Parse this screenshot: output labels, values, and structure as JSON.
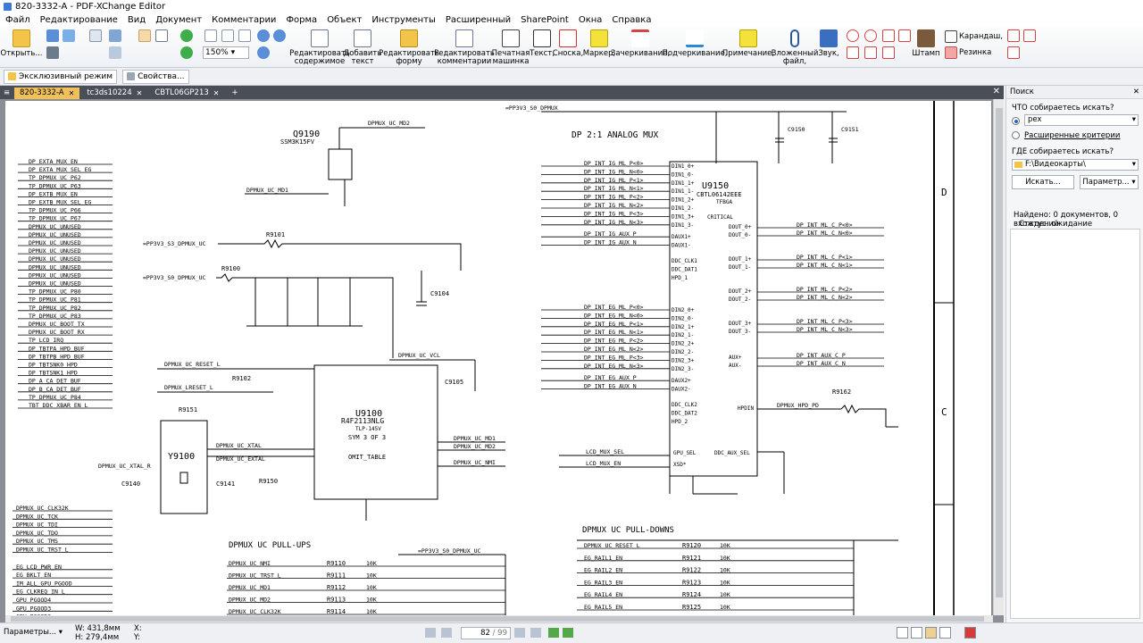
{
  "window": {
    "title": "820-3332-A - PDF-XChange Editor"
  },
  "menu": [
    "Файл",
    "Редактирование",
    "Вид",
    "Документ",
    "Комментарии",
    "Форма",
    "Объект",
    "Инструменты",
    "Расширенный",
    "SharePoint",
    "Окна",
    "Справка"
  ],
  "toolbar": {
    "open": "Открыть...",
    "zoom": "150%",
    "edit_content": [
      "Редактировать",
      "содержимое"
    ],
    "add_text": [
      "Добавить",
      "текст"
    ],
    "edit_form": [
      "Редактировать",
      "форму"
    ],
    "edit_comments": [
      "Редактировать",
      "комментарии"
    ],
    "typewriter": [
      "Печатная",
      "машинка"
    ],
    "text": "Текст,",
    "callout": "Сноска,",
    "highlight": "Маркер,",
    "strikeout": "Зачеркивание,",
    "underline": "Подчеркивание,",
    "note": "Примечание,",
    "attachment": [
      "Вложенный",
      "файл,"
    ],
    "sound": "Звук,",
    "stamp": "Штамп",
    "pencil": "Карандаш,",
    "eraser": "Резинка"
  },
  "modebar": {
    "exclusive": "Эксклюзивный режим",
    "properties": "Свойства..."
  },
  "tabs": [
    {
      "label": "820-3332-A",
      "active": true
    },
    {
      "label": "tc3ds10224",
      "active": false
    },
    {
      "label": "CBTL06GP213",
      "active": false
    }
  ],
  "schematic": {
    "title_dp": "DP 2:1 ANALOG MUX",
    "u9150": "U9150",
    "u9150_part": "CBTL06142EEE",
    "u9150_pkg": "TFBGA",
    "critical": "CRITICAL",
    "u9100": "U9100",
    "u9100_part": "R4F2113NLG",
    "u9100_pkg": "TLP-145V",
    "sym": "SYM 3 OF 3",
    "omit": "OMIT_TABLE",
    "q9190": "Q9190",
    "q9190_part": "SSM3K15FV",
    "y9100": "Y9100",
    "pullups": "DPMUX UC PULL-UPS",
    "pulldowns": "DPMUX UC PULL-DOWNS",
    "pp3v3_s0": "=PP3V3_S0_DPMUX",
    "pp3v3_s3": "=PP3V3_S3_DPMUX_UC",
    "pp3v3_s0uc": "=PP3V3_S0_DPMUX_UC",
    "zone_d": "D",
    "zone_c": "C",
    "c9104": "C9104",
    "c9105": "C9105",
    "c9150": "C9150",
    "c9151": "C9151",
    "r9162": "R9162",
    "r9101": "R9101",
    "r9100": "R9100",
    "r9102": "R9102",
    "r9151": "R9151",
    "r9150": "R9150",
    "c9140": "C9140",
    "c9141": "C9141",
    "md2": "DPMUX_UC_MD2",
    "md1": "DPMUX_UC_MD1",
    "vcl": "DPMUX_UC_VCL",
    "reset_l": "DPMUX_UC_RESET_L",
    "lreset_l": "DPMUX_LRESET_L",
    "xtal": "DPMUX_UC_XTAL",
    "extal": "DPMUX_UC_EXTAL",
    "xtal_r": "DPMUX_UC_XTAL_R",
    "nmi": "DPMUX_UC_NMI",
    "hpd_pd": "DPMUX_HPD_PD",
    "gpu_sel": "LCD_MUX_SEL",
    "lcd_mux_en": "LCD_MUX_EN",
    "left_nets": [
      "DP_EXTA_MUX_EN",
      "DP_EXTA_MUX_SEL_EG",
      "TP_DPMUX_UC_P62",
      "TP_DPMUX_UC_P63",
      "DP_EXTB_MUX_EN",
      "DP_EXTB_MUX_SEL_EG",
      "TP_DPMUX_UC_P66",
      "TP_DPMUX_UC_P67",
      "DPMUX_UC_UNUSED",
      "DPMUX_UC_UNUSED",
      "DPMUX_UC_UNUSED",
      "DPMUX_UC_UNUSED",
      "DPMUX_UC_UNUSED",
      "DPMUX_UC_UNUSED",
      "DPMUX_UC_UNUSED",
      "DPMUX_UC_UNUSED",
      "TP_DPMUX_UC_P80",
      "TP_DPMUX_UC_P81",
      "TP_DPMUX_UC_P82",
      "TP_DPMUX_UC_P83",
      "DPMUX_UC_BOOT_TX",
      "DPMUX_UC_BOOT_RX",
      "TP_LCD_IRQ",
      "DP_TBTPA_HPD_BUF",
      "DP_TBTPB_HPD_BUF",
      "DP_TBTSNK0_HPD",
      "DP_TBTSNK1_HPD",
      "DP_A_CA_DET_BUF",
      "DP_B_CA_DET_BUF",
      "TP_DPMUX_UC_P84",
      "TBT_DDC_XBAR_EN_L"
    ],
    "left_nets_bottom": [
      "DPMUX_UC_CLK32K",
      "DPMUX_UC_TCK",
      "DPMUX_UC_TDI",
      "DPMUX_UC_TDO",
      "DPMUX_UC_TMS",
      "DPMUX_UC_TRST_L",
      "EG_LCD_PWR_EN",
      "EG_BKLT_EN",
      "IM_ALL_GPU_PGOOD",
      "EG_CLKREQ_IN_L",
      "GPU_PGOOD4",
      "GPU_PGOOD3",
      "GPU_PGOOD2"
    ],
    "mid_nets": [
      "DP_INT_IG_ML_P<0>",
      "DP_INT_IG_ML_N<0>",
      "DP_INT_IG_ML_P<1>",
      "DP_INT_IG_ML_N<1>",
      "DP_INT_IG_ML_P<2>",
      "DP_INT_IG_ML_N<2>",
      "DP_INT_IG_ML_P<3>",
      "DP_INT_IG_ML_N<3>",
      "DP_INT_IG_AUX_P",
      "DP_INT_IG_AUX_N"
    ],
    "mid_nets2": [
      "DP_INT_EG_ML_P<0>",
      "DP_INT_EG_ML_N<0>",
      "DP_INT_EG_ML_P<1>",
      "DP_INT_EG_ML_N<1>",
      "DP_INT_EG_ML_P<2>",
      "DP_INT_EG_ML_N<2>",
      "DP_INT_EG_ML_P<3>",
      "DP_INT_EG_ML_N<3>",
      "DP_INT_EG_AUX_P",
      "DP_INT_EG_AUX_N"
    ],
    "u_pins_left": [
      "DIN1_0+",
      "DIN1_0-",
      "DIN1_1+",
      "DIN1_1-",
      "DIN1_2+",
      "DIN1_2-",
      "DIN1_3+",
      "DIN1_3-",
      "DAUX1+",
      "DAUX1-",
      "DDC_CLK1",
      "DDC_DAT1",
      "HPD_1",
      "DIN2_0+",
      "DIN2_0-",
      "DIN2_1+",
      "DIN2_1-",
      "DIN2_2+",
      "DIN2_2-",
      "DIN2_3+",
      "DIN2_3-",
      "DAUX2+",
      "DAUX2-",
      "DDC_CLK2",
      "DDC_DAT2",
      "HPD_2",
      "GPU_SEL",
      "XSD*"
    ],
    "u_pins_right": [
      "DOUT_0+",
      "DOUT_0-",
      "DOUT_1+",
      "DOUT_1-",
      "DOUT_2+",
      "DOUT_2-",
      "DOUT_3+",
      "DOUT_3-",
      "AUX+",
      "AUX-",
      "HPDIN",
      "DDC_AUX_SEL"
    ],
    "right_nets": [
      "DP_INT_ML_C_P<0>",
      "DP_INT_ML_C_N<0>",
      "DP_INT_ML_C_P<1>",
      "DP_INT_ML_C_N<1>",
      "DP_INT_ML_C_P<2>",
      "DP_INT_ML_C_N<2>",
      "DP_INT_ML_C_P<3>",
      "DP_INT_ML_C_N<3>",
      "DP_INT_AUX_C_P",
      "DP_INT_AUX_C_N"
    ],
    "pullup_rows": [
      {
        "net": "DPMUX_UC_NMI",
        "ref": "R9110",
        "val": "10K"
      },
      {
        "net": "DPMUX_UC_TRST_L",
        "ref": "R9111",
        "val": "10K"
      },
      {
        "net": "DPMUX_UC_MD1",
        "ref": "R9112",
        "val": "10K"
      },
      {
        "net": "DPMUX_UC_MD2",
        "ref": "R9113",
        "val": "10K"
      },
      {
        "net": "DPMUX_UC_CLK32K",
        "ref": "R9114",
        "val": "10K"
      }
    ],
    "pulldown_rows": [
      {
        "net": "DPMUX_UC_RESET_L",
        "ref": "R9120",
        "val": "10K"
      },
      {
        "net": "EG_RAIL1_EN",
        "ref": "R9121",
        "val": "10K"
      },
      {
        "net": "EG_RAIL2_EN",
        "ref": "R9122",
        "val": "10K"
      },
      {
        "net": "EG_RAIL3_EN",
        "ref": "R9123",
        "val": "10K"
      },
      {
        "net": "EG_RAIL4_EN",
        "ref": "R9124",
        "val": "10K"
      },
      {
        "net": "EG_RAIL5_EN",
        "ref": "R9125",
        "val": "10K"
      }
    ]
  },
  "search": {
    "title": "Поиск",
    "what_label": "ЧТО собираетесь искать?",
    "query": "pex",
    "advanced": "Расширенные критерии",
    "where_label": "ГДЕ собираетесь искать?",
    "where": "F:\\Видеокарты\\",
    "search_btn": "Искать...",
    "params_btn": "Параметр...",
    "found": "Найдено: 0 документов, 0 вхождений",
    "status": "Статус: ожидание"
  },
  "statusbar": {
    "params": "Параметры...",
    "width": "W: 431,8мм",
    "height": "H: 279,4мм",
    "xy": "X:",
    "y": "Y:",
    "page": "82",
    "total": "/ 99"
  }
}
